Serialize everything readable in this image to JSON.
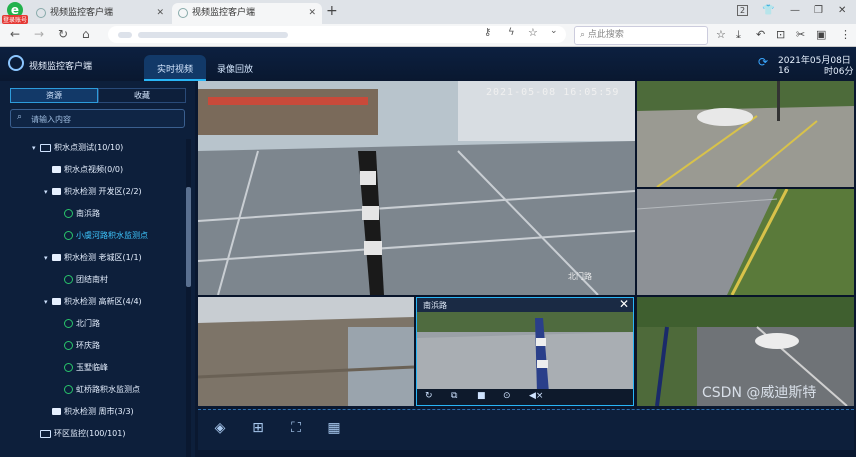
{
  "browser": {
    "badge": "登录账号",
    "tabs": [
      {
        "label": "视频监控客户端",
        "active": false
      },
      {
        "label": "视频监控客户端",
        "active": true
      }
    ],
    "new_tab": "+",
    "tab_count": "2",
    "search_placeholder": "点此搜索"
  },
  "app": {
    "title": "视频监控客户端",
    "main_tabs": [
      {
        "label": "实时视频",
        "active": true
      },
      {
        "label": "录像回放",
        "active": false
      }
    ],
    "datetime_line1": "2021年05月08日 16",
    "datetime_line2": "时06分",
    "accent": "#29b6f6"
  },
  "sidebar": {
    "tabs": [
      {
        "label": "资源"
      },
      {
        "label": "收藏"
      }
    ],
    "search_placeholder": "请输入内容",
    "tree": [
      {
        "label": "积水点测试(10/10)",
        "type": "folder",
        "expanded": true,
        "depth": 0
      },
      {
        "label": "积水点视频(0/0)",
        "type": "group",
        "depth": 1
      },
      {
        "label": "积水检测 开发区(2/2)",
        "type": "group",
        "expanded": true,
        "depth": 1
      },
      {
        "label": "南浜路",
        "type": "camera",
        "depth": 2
      },
      {
        "label": "小虞河路积水监测点",
        "type": "camera",
        "depth": 2,
        "selected": true
      },
      {
        "label": "积水检测 老城区(1/1)",
        "type": "group",
        "expanded": true,
        "depth": 1
      },
      {
        "label": "团结南村",
        "type": "camera",
        "depth": 2
      },
      {
        "label": "积水检测 高新区(4/4)",
        "type": "group",
        "expanded": true,
        "depth": 1
      },
      {
        "label": "北门路",
        "type": "camera",
        "depth": 2
      },
      {
        "label": "环庆路",
        "type": "camera",
        "depth": 2
      },
      {
        "label": "玉墅临峰",
        "type": "camera",
        "depth": 2
      },
      {
        "label": "虹桥路积水监测点",
        "type": "camera",
        "depth": 2
      },
      {
        "label": "积水检测 周市(3/3)",
        "type": "group",
        "depth": 1
      },
      {
        "label": "环区监控(100/101)",
        "type": "folder",
        "depth": 0
      }
    ]
  },
  "videos": {
    "main_timestamp": "2021-05-08 16:05:59",
    "main_corner": "北门路",
    "selected_cell_title": "南浜路",
    "close_glyph": "✕"
  },
  "bottom_toolbar": [
    "layers-icon",
    "grid-4-icon",
    "fullscreen-icon",
    "grid-9-icon"
  ],
  "watermark": "CSDN @威迪斯特"
}
